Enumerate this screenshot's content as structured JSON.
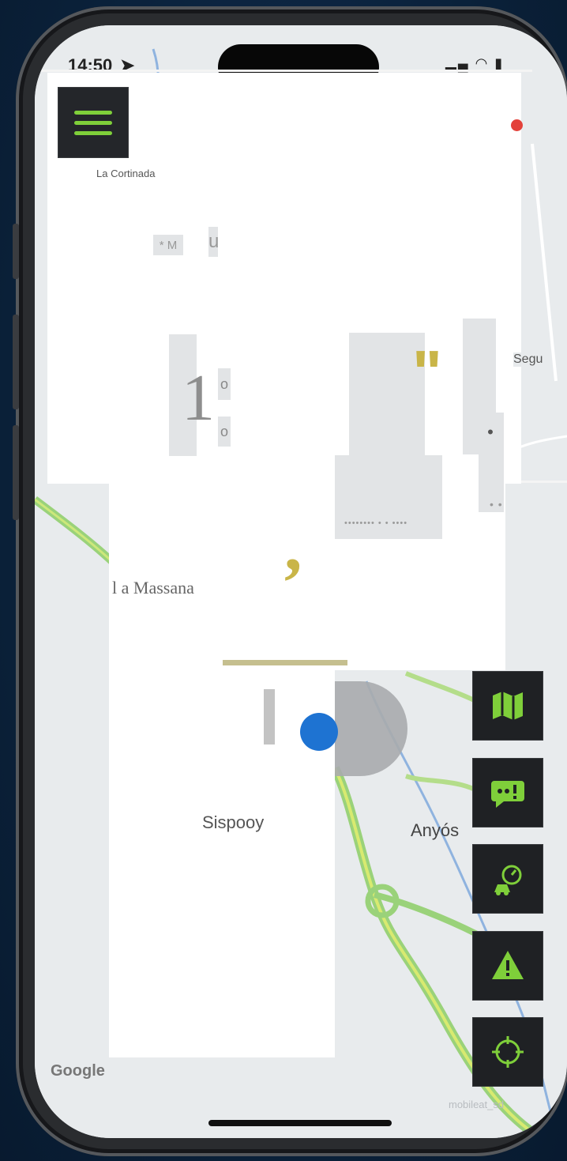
{
  "status_bar": {
    "time": "14:50"
  },
  "menu": {
    "button_label": "Menu"
  },
  "map": {
    "labels": {
      "la_cortinada": "La Cortinada",
      "segu": "Segu",
      "la_massana": "l a Massana",
      "anyos": "Anyós",
      "sispony": "Sispooy",
      "google": "Google",
      "watermark": "mobileat_sd"
    }
  },
  "overlay": {
    "tag_m": "* M",
    "tag_u": "u",
    "big_one": "1",
    "small_o_1": "o",
    "small_o_2": "o",
    "quote": "\"",
    "comma": ",",
    "dots": "•••••••• • • ••••",
    "dots_small": "• •"
  },
  "side_buttons": [
    {
      "icon": "map-icon"
    },
    {
      "icon": "chat-alert-icon"
    },
    {
      "icon": "speed-camera-icon"
    },
    {
      "icon": "warning-icon"
    },
    {
      "icon": "locate-icon"
    }
  ],
  "colors": {
    "accent_green": "#7fcf3a",
    "accent_gold": "#c9b548",
    "user_blue": "#1e73d2",
    "alert_red": "#e3413a"
  }
}
